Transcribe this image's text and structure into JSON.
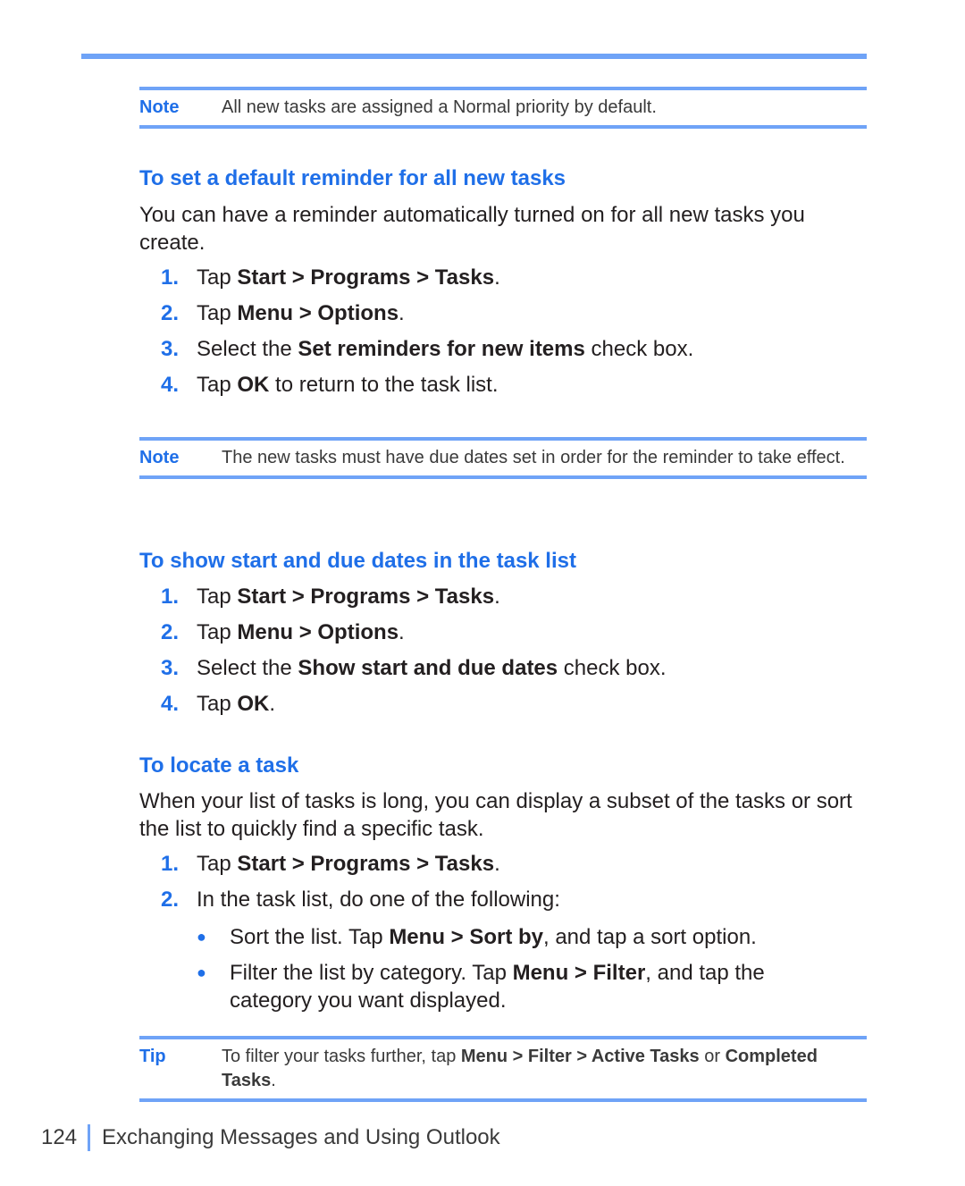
{
  "note1": {
    "label": "Note",
    "text": "All new tasks are assigned a Normal priority by default."
  },
  "section1": {
    "heading": "To set a default reminder for all new tasks",
    "intro": "You can have a reminder automatically turned on for all new tasks you create.",
    "steps": [
      {
        "num": "1.",
        "pre": "Tap ",
        "bold": "Start > Programs > Tasks",
        "post": "."
      },
      {
        "num": "2.",
        "pre": "Tap ",
        "bold": "Menu > Options",
        "post": "."
      },
      {
        "num": "3.",
        "pre": "Select the ",
        "bold": "Set reminders for new items",
        "post": " check box."
      },
      {
        "num": "4.",
        "pre": "Tap ",
        "bold": "OK",
        "post": " to return to the task list."
      }
    ]
  },
  "note2": {
    "label": "Note",
    "text": "The new tasks must have due dates set in order for the reminder to take effect."
  },
  "section2": {
    "heading": "To show start and due dates in the task list",
    "steps": [
      {
        "num": "1.",
        "pre": "Tap ",
        "bold": "Start > Programs > Tasks",
        "post": "."
      },
      {
        "num": "2.",
        "pre": "Tap ",
        "bold": "Menu > Options",
        "post": "."
      },
      {
        "num": "3.",
        "pre": "Select the ",
        "bold": "Show start and due dates",
        "post": " check box."
      },
      {
        "num": "4.",
        "pre": "Tap ",
        "bold": "OK",
        "post": "."
      }
    ]
  },
  "section3": {
    "heading": "To locate a task",
    "intro": "When your list of tasks is long, you can display a subset of the tasks or sort the list to quickly find a specific task.",
    "steps": [
      {
        "num": "1.",
        "pre": "Tap ",
        "bold": "Start > Programs > Tasks",
        "post": "."
      },
      {
        "num": "2.",
        "pre": "In the task list, do one of the following:",
        "bold": "",
        "post": ""
      }
    ],
    "bullets": [
      {
        "pre": "Sort the list. Tap ",
        "bold": "Menu > Sort by",
        "post": ", and tap a sort option."
      },
      {
        "pre": "Filter the list by category. Tap ",
        "bold": "Menu > Filter",
        "post": ", and tap the category you want displayed."
      }
    ]
  },
  "tip": {
    "label": "Tip",
    "pre": "To filter your tasks further, tap ",
    "bold1": "Menu > Filter > Active Tasks",
    "mid": " or ",
    "bold2": "Completed Tasks",
    "post": "."
  },
  "footer": {
    "page": "124",
    "chapter": "Exchanging Messages and Using Outlook"
  }
}
